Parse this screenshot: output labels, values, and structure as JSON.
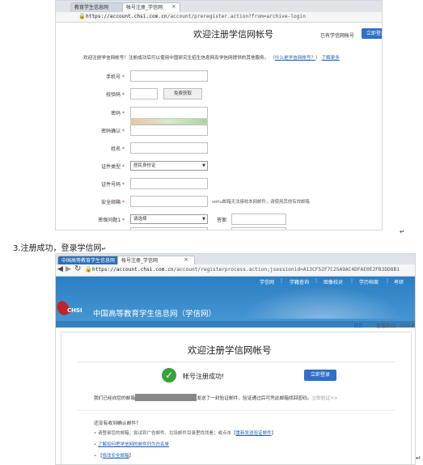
{
  "top_shot": {
    "tabs": [
      "教育学生信息网",
      "帐号注册_学信网"
    ],
    "tab_close": "×",
    "url_host": "https://account.chsi.com.cn",
    "url_path": "/account/preregister.action?from=archive-login",
    "heading": "欢迎注册学信网帐号",
    "have_account": "已有学信网帐号",
    "login_btn": "立即登录",
    "intro": "欢迎注册学信网帐号！注册成功后可以使用中国研究生招生信息网及学信网提供的其他服务。",
    "intro_link1": "什么是学信网帐号？",
    "intro_link2": "了解更多",
    "fields": [
      {
        "label": "手机号"
      },
      {
        "label": "校验码",
        "button": "免费获取"
      },
      {
        "label": "密码"
      },
      {
        "label": "密码确认"
      },
      {
        "label": "姓名"
      },
      {
        "label": "证件类型",
        "value": "居民身份证"
      },
      {
        "label": "证件号码"
      },
      {
        "label": "安全邮箱",
        "hint": "sohu邮箱无法接收本网邮件，请使用其他有效邮箱"
      },
      {
        "label": "密保问题1",
        "value": "请选择",
        "answer_label": "答案"
      }
    ],
    "required_mark": "*"
  },
  "step_caption": "3.注册成功，登录学信网",
  "paragraph_mark": "↵",
  "bottom_shot": {
    "tabs": [
      "中国高等教育学生信息网",
      "帐号注册_学信网"
    ],
    "tab_close": "×",
    "url_host": "https://account.chsi.com.cn",
    "url_path": "/account/registerprocess.action;jsessionid=A13CF52F7C25A9AC4DFAE0E2FB3DD8B1",
    "nav": [
      "学信网",
      "学籍查询",
      "图像校对",
      "学历档案",
      "考研"
    ],
    "nav_sep": "|",
    "site_logo": "CHSI",
    "site_title": "中国高等教育学生信息网（学信网）",
    "sub_nav": [
      "首页",
      "客服热线：010-6"
    ],
    "heading": "欢迎注册学信网帐号",
    "success": "帐号注册成功!",
    "login_btn": "立即登录",
    "email_sent_pre": "我们已经向您的邮箱",
    "email_sent_post": "发送了一封验证邮件，验证通过后可凭此邮箱找回密码。",
    "email_sent_link": "立即验证>>",
    "not_received": "还没有收到确认邮件？",
    "tips": [
      {
        "text": "请登录您的邮箱，尝试到广告邮件、垃圾邮件目录里找找看；或点击",
        "link": "重新发送验证邮件"
      },
      {
        "text": "",
        "link": "了解如何把学信网的邮件列为白名单"
      },
      {
        "text": "",
        "link": "修改安全邮箱"
      }
    ],
    "colors": {
      "nav_bg": "#2a7fc4",
      "accent": "#2f6fc9",
      "success": "#3aa23a"
    }
  }
}
